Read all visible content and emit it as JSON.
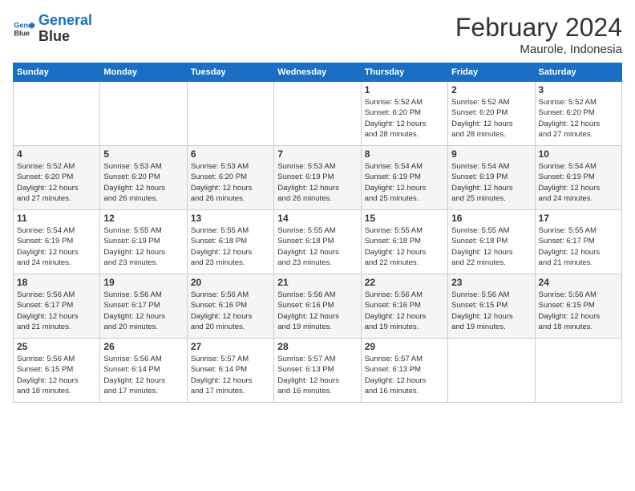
{
  "logo": {
    "line1": "General",
    "line2": "Blue"
  },
  "title": "February 2024",
  "subtitle": "Maurole, Indonesia",
  "days_of_week": [
    "Sunday",
    "Monday",
    "Tuesday",
    "Wednesday",
    "Thursday",
    "Friday",
    "Saturday"
  ],
  "weeks": [
    [
      {
        "day": "",
        "info": ""
      },
      {
        "day": "",
        "info": ""
      },
      {
        "day": "",
        "info": ""
      },
      {
        "day": "",
        "info": ""
      },
      {
        "day": "1",
        "info": "Sunrise: 5:52 AM\nSunset: 6:20 PM\nDaylight: 12 hours\nand 28 minutes."
      },
      {
        "day": "2",
        "info": "Sunrise: 5:52 AM\nSunset: 6:20 PM\nDaylight: 12 hours\nand 28 minutes."
      },
      {
        "day": "3",
        "info": "Sunrise: 5:52 AM\nSunset: 6:20 PM\nDaylight: 12 hours\nand 27 minutes."
      }
    ],
    [
      {
        "day": "4",
        "info": "Sunrise: 5:52 AM\nSunset: 6:20 PM\nDaylight: 12 hours\nand 27 minutes."
      },
      {
        "day": "5",
        "info": "Sunrise: 5:53 AM\nSunset: 6:20 PM\nDaylight: 12 hours\nand 26 minutes."
      },
      {
        "day": "6",
        "info": "Sunrise: 5:53 AM\nSunset: 6:20 PM\nDaylight: 12 hours\nand 26 minutes."
      },
      {
        "day": "7",
        "info": "Sunrise: 5:53 AM\nSunset: 6:19 PM\nDaylight: 12 hours\nand 26 minutes."
      },
      {
        "day": "8",
        "info": "Sunrise: 5:54 AM\nSunset: 6:19 PM\nDaylight: 12 hours\nand 25 minutes."
      },
      {
        "day": "9",
        "info": "Sunrise: 5:54 AM\nSunset: 6:19 PM\nDaylight: 12 hours\nand 25 minutes."
      },
      {
        "day": "10",
        "info": "Sunrise: 5:54 AM\nSunset: 6:19 PM\nDaylight: 12 hours\nand 24 minutes."
      }
    ],
    [
      {
        "day": "11",
        "info": "Sunrise: 5:54 AM\nSunset: 6:19 PM\nDaylight: 12 hours\nand 24 minutes."
      },
      {
        "day": "12",
        "info": "Sunrise: 5:55 AM\nSunset: 6:19 PM\nDaylight: 12 hours\nand 23 minutes."
      },
      {
        "day": "13",
        "info": "Sunrise: 5:55 AM\nSunset: 6:18 PM\nDaylight: 12 hours\nand 23 minutes."
      },
      {
        "day": "14",
        "info": "Sunrise: 5:55 AM\nSunset: 6:18 PM\nDaylight: 12 hours\nand 23 minutes."
      },
      {
        "day": "15",
        "info": "Sunrise: 5:55 AM\nSunset: 6:18 PM\nDaylight: 12 hours\nand 22 minutes."
      },
      {
        "day": "16",
        "info": "Sunrise: 5:55 AM\nSunset: 6:18 PM\nDaylight: 12 hours\nand 22 minutes."
      },
      {
        "day": "17",
        "info": "Sunrise: 5:55 AM\nSunset: 6:17 PM\nDaylight: 12 hours\nand 21 minutes."
      }
    ],
    [
      {
        "day": "18",
        "info": "Sunrise: 5:56 AM\nSunset: 6:17 PM\nDaylight: 12 hours\nand 21 minutes."
      },
      {
        "day": "19",
        "info": "Sunrise: 5:56 AM\nSunset: 6:17 PM\nDaylight: 12 hours\nand 20 minutes."
      },
      {
        "day": "20",
        "info": "Sunrise: 5:56 AM\nSunset: 6:16 PM\nDaylight: 12 hours\nand 20 minutes."
      },
      {
        "day": "21",
        "info": "Sunrise: 5:56 AM\nSunset: 6:16 PM\nDaylight: 12 hours\nand 19 minutes."
      },
      {
        "day": "22",
        "info": "Sunrise: 5:56 AM\nSunset: 6:16 PM\nDaylight: 12 hours\nand 19 minutes."
      },
      {
        "day": "23",
        "info": "Sunrise: 5:56 AM\nSunset: 6:15 PM\nDaylight: 12 hours\nand 19 minutes."
      },
      {
        "day": "24",
        "info": "Sunrise: 5:56 AM\nSunset: 6:15 PM\nDaylight: 12 hours\nand 18 minutes."
      }
    ],
    [
      {
        "day": "25",
        "info": "Sunrise: 5:56 AM\nSunset: 6:15 PM\nDaylight: 12 hours\nand 18 minutes."
      },
      {
        "day": "26",
        "info": "Sunrise: 5:56 AM\nSunset: 6:14 PM\nDaylight: 12 hours\nand 17 minutes."
      },
      {
        "day": "27",
        "info": "Sunrise: 5:57 AM\nSunset: 6:14 PM\nDaylight: 12 hours\nand 17 minutes."
      },
      {
        "day": "28",
        "info": "Sunrise: 5:57 AM\nSunset: 6:13 PM\nDaylight: 12 hours\nand 16 minutes."
      },
      {
        "day": "29",
        "info": "Sunrise: 5:57 AM\nSunset: 6:13 PM\nDaylight: 12 hours\nand 16 minutes."
      },
      {
        "day": "",
        "info": ""
      },
      {
        "day": "",
        "info": ""
      }
    ]
  ]
}
